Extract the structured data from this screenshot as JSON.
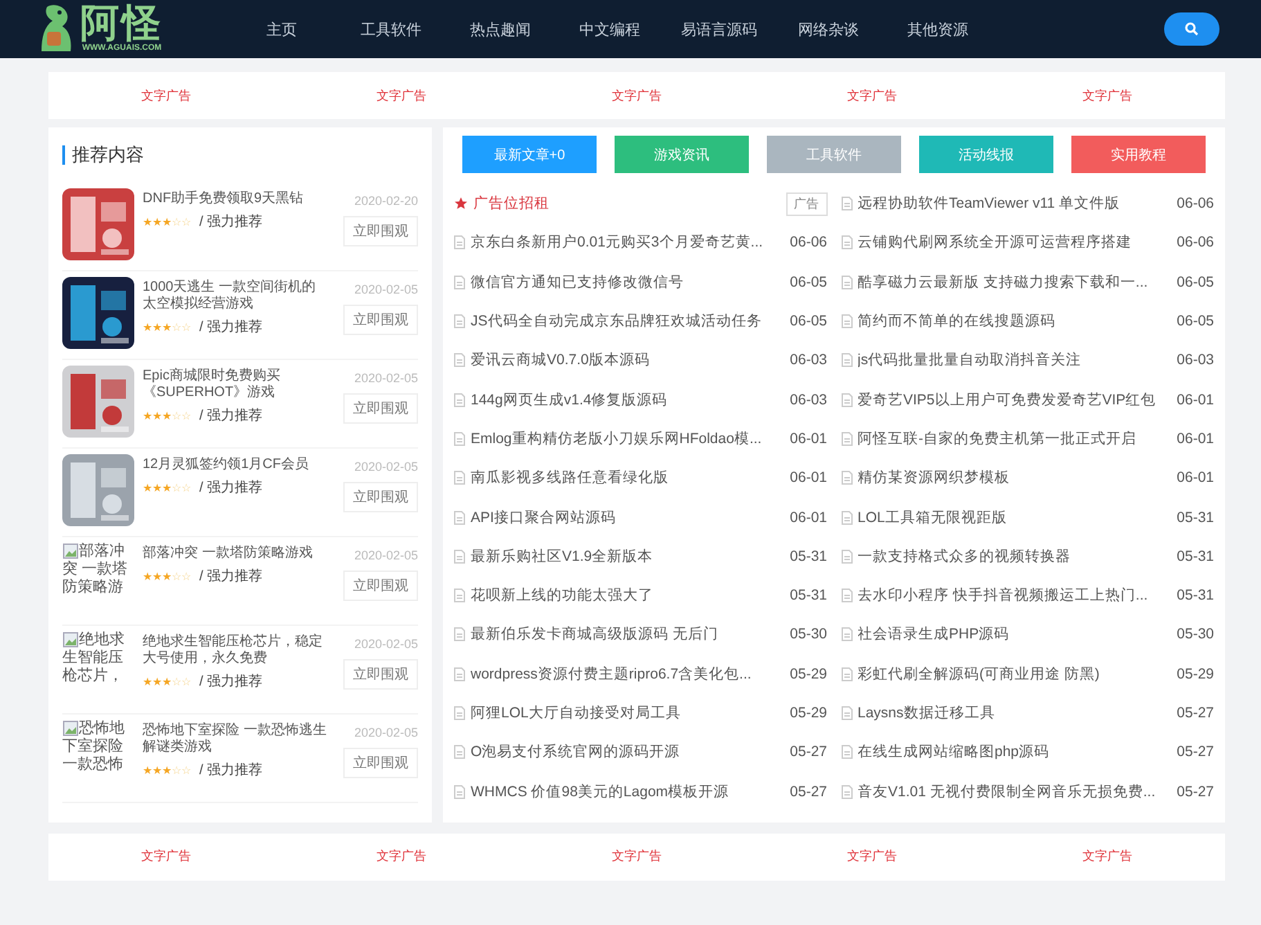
{
  "header": {
    "logo_text": "阿怪",
    "logo_url": "WWW.AGUAIS.COM",
    "nav": [
      {
        "label": "主页"
      },
      {
        "label": "工具软件"
      },
      {
        "label": "热点趣闻"
      },
      {
        "label": "中文编程"
      },
      {
        "label": "易语言源码"
      },
      {
        "label": "网络杂谈"
      },
      {
        "label": "其他资源"
      }
    ]
  },
  "top_ads": [
    "文字广告",
    "文字广告",
    "文字广告",
    "文字广告",
    "文字广告"
  ],
  "recommend": {
    "title": "推荐内容",
    "items": [
      {
        "kind": "picture",
        "title": "DNF助手免费领取9天黑钻",
        "stars": 3,
        "tag": "/ 强力推荐",
        "date": "2020-02-20",
        "button": "立即围观"
      },
      {
        "kind": "picture",
        "title": "1000天逃生 一款空间街机的太空模拟经营游戏",
        "stars": 3,
        "tag": "/ 强力推荐",
        "date": "2020-02-05",
        "button": "立即围观"
      },
      {
        "kind": "picture",
        "title": "Epic商城限时免费购买《SUPERHOT》游戏",
        "stars": 3,
        "tag": "/ 强力推荐",
        "date": "2020-02-05",
        "button": "立即围观"
      },
      {
        "kind": "picture",
        "title": "12月灵狐签约领1月CF会员",
        "stars": 3,
        "tag": "/ 强力推荐",
        "date": "2020-02-05",
        "button": "立即围观"
      },
      {
        "kind": "broken",
        "alt": "部落冲突 一款塔防策略游",
        "title": "部落冲突 一款塔防策略游戏",
        "stars": 3,
        "tag": "/ 强力推荐",
        "date": "2020-02-05",
        "button": "立即围观"
      },
      {
        "kind": "broken",
        "alt": "绝地求生智能压枪芯片，",
        "title": "绝地求生智能压枪芯片，稳定大号使用，永久免费",
        "stars": 3,
        "tag": "/ 强力推荐",
        "date": "2020-02-05",
        "button": "立即围观"
      },
      {
        "kind": "broken",
        "alt": "恐怖地下室探险一款恐怖",
        "title": "恐怖地下室探险 一款恐怖逃生解谜类游戏",
        "stars": 3,
        "tag": "/ 强力推荐",
        "date": "2020-02-05",
        "button": "立即围观"
      }
    ]
  },
  "tabs": [
    {
      "label": "最新文章+0",
      "color": "#1e9fff"
    },
    {
      "label": "游戏资讯",
      "color": "#2dbe7e"
    },
    {
      "label": "工具软件",
      "color": "#aab6bf"
    },
    {
      "label": "活动线报",
      "color": "#1fb9b6"
    },
    {
      "label": "实用教程",
      "color": "#f25c5c"
    }
  ],
  "ad_header": {
    "title": "广告位招租",
    "badge": "广告"
  },
  "left_articles": [
    {
      "title": "京东白条新用户0.01元购买3个月爱奇艺黄...",
      "date": "06-06"
    },
    {
      "title": "微信官方通知已支持修改微信号",
      "date": "06-05"
    },
    {
      "title": "JS代码全自动完成京东品牌狂欢城活动任务",
      "date": "06-05"
    },
    {
      "title": "爱讯云商城V0.7.0版本源码",
      "date": "06-03"
    },
    {
      "title": "144g网页生成v1.4修复版源码",
      "date": "06-03"
    },
    {
      "title": "Emlog重构精仿老版小刀娱乐网HFoldao模...",
      "date": "06-01"
    },
    {
      "title": "南瓜影视多线路任意看绿化版",
      "date": "06-01"
    },
    {
      "title": "API接口聚合网站源码",
      "date": "06-01"
    },
    {
      "title": "最新乐购社区V1.9全新版本",
      "date": "05-31"
    },
    {
      "title": "花呗新上线的功能太强大了",
      "date": "05-31"
    },
    {
      "title": "最新伯乐发卡商城高级版源码 无后门",
      "date": "05-30"
    },
    {
      "title": "wordpress资源付费主题ripro6.7含美化包...",
      "date": "05-29"
    },
    {
      "title": "阿狸LOL大厅自动接受对局工具",
      "date": "05-29"
    },
    {
      "title": "O泡易支付系统官网的源码开源",
      "date": "05-27"
    },
    {
      "title": "WHMCS 价值98美元的Lagom模板开源",
      "date": "05-27"
    }
  ],
  "right_articles": [
    {
      "title": "远程协助软件TeamViewer v11 单文件版",
      "date": "06-06"
    },
    {
      "title": "云铺购代刷网系统全开源可运营程序搭建",
      "date": "06-06"
    },
    {
      "title": "酷享磁力云最新版 支持磁力搜索下载和一...",
      "date": "06-05"
    },
    {
      "title": "简约而不简单的在线搜题源码",
      "date": "06-05"
    },
    {
      "title": "js代码批量批量自动取消抖音关注",
      "date": "06-03"
    },
    {
      "title": "爱奇艺VIP5以上用户可免费发爱奇艺VIP红包",
      "date": "06-01"
    },
    {
      "title": "阿怪互联-自家的免费主机第一批正式开启",
      "date": "06-01"
    },
    {
      "title": "精仿某资源网织梦模板",
      "date": "06-01"
    },
    {
      "title": "LOL工具箱无限视距版",
      "date": "05-31"
    },
    {
      "title": "一款支持格式众多的视频转换器",
      "date": "05-31"
    },
    {
      "title": "去水印小程序 快手抖音视频搬运工上热门...",
      "date": "05-31"
    },
    {
      "title": "社会语录生成PHP源码",
      "date": "05-30"
    },
    {
      "title": "彩虹代刷全解源码(可商业用途 防黑)",
      "date": "05-29"
    },
    {
      "title": "Laysns数据迁移工具",
      "date": "05-27"
    },
    {
      "title": "在线生成网站缩略图php源码",
      "date": "05-27"
    },
    {
      "title": "音友V1.01 无视付费限制全网音乐无损免费...",
      "date": "05-27"
    }
  ],
  "bottom_ads": [
    "文字广告",
    "文字广告",
    "文字广告",
    "文字广告",
    "文字广告"
  ]
}
